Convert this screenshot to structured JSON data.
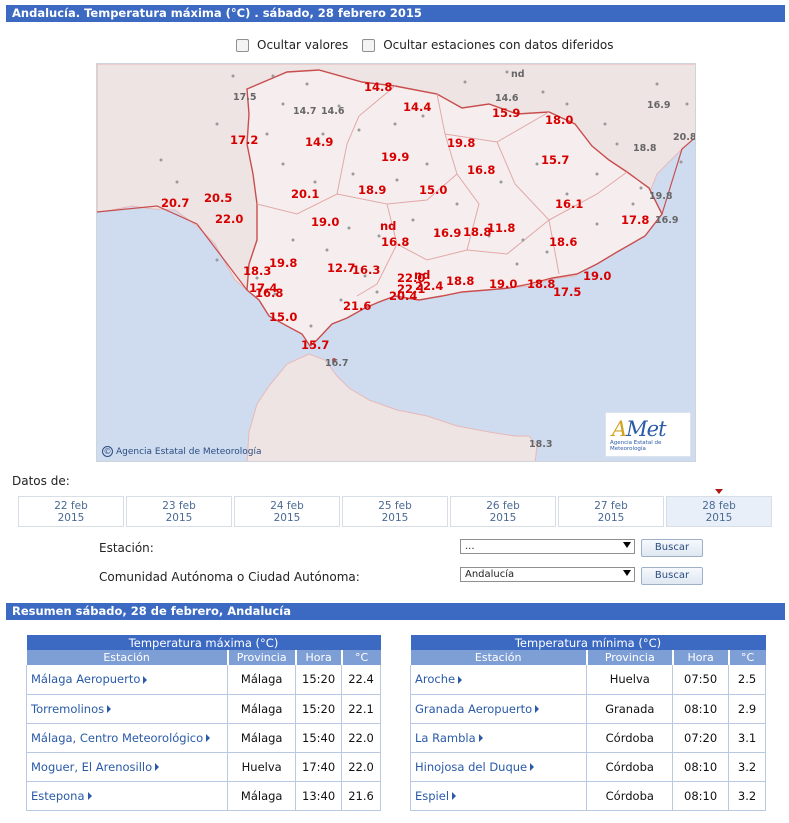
{
  "header": {
    "title": "Andalucía. Temperatura máxima (°C) . sábado, 28 febrero 2015"
  },
  "options": {
    "hide_values": "Ocultar valores",
    "hide_deferred": "Ocultar estaciones con datos diferidos"
  },
  "map": {
    "credit": "Agencia Estatal de Meteorología",
    "logo_text": "Met",
    "logo_letter": "A",
    "logo_subtitle": "Agencia Estatal de Meteorología",
    "values": [
      "14.8",
      "14.4",
      "15.9",
      "18.0",
      "17.2",
      "14.9",
      "19.9",
      "19.8",
      "15.7",
      "16.8",
      "20.1",
      "18.9",
      "15.0",
      "20.7",
      "20.5",
      "22.0",
      "19.0",
      "16.1",
      "17.8",
      "nd",
      "16.8",
      "16.9",
      "18.8",
      "11.8",
      "18.6",
      "19.8",
      "12.7",
      "16.3",
      "18.3",
      "22.0",
      "nd",
      "17.4",
      "16.8",
      "22.1",
      "22.4",
      "18.8",
      "19.0",
      "18.8",
      "17.5",
      "19.0",
      "20.4",
      "21.6",
      "15.0",
      "15.7"
    ],
    "grey_values": [
      "17.5",
      "14.7",
      "14.6",
      "nd",
      "14.6",
      "16.9",
      "20.8",
      "18.8",
      "19.8",
      "16.9",
      "16.7",
      "18.3"
    ]
  },
  "dates": {
    "label": "Datos de:",
    "items": [
      {
        "day": "22 feb",
        "year": "2015"
      },
      {
        "day": "23 feb",
        "year": "2015"
      },
      {
        "day": "24 feb",
        "year": "2015"
      },
      {
        "day": "25 feb",
        "year": "2015"
      },
      {
        "day": "26 feb",
        "year": "2015"
      },
      {
        "day": "27 feb",
        "year": "2015"
      },
      {
        "day": "28 feb",
        "year": "2015"
      }
    ]
  },
  "form": {
    "station_label": "Estación:",
    "station_value": "...",
    "community_label": "Comunidad Autónoma o Ciudad Autónoma:",
    "community_value": "Andalucía",
    "search": "Buscar"
  },
  "summary": {
    "title": "Resumen sábado, 28 de febrero, Andalucía",
    "columns": [
      "Estación",
      "Provincia",
      "Hora",
      "°C"
    ],
    "max": {
      "caption": "Temperatura máxima (°C)",
      "rows": [
        [
          "Málaga Aeropuerto",
          "Málaga",
          "15:20",
          "22.4"
        ],
        [
          "Torremolinos",
          "Málaga",
          "15:20",
          "22.1"
        ],
        [
          "Málaga, Centro Meteorológico",
          "Málaga",
          "15:40",
          "22.0"
        ],
        [
          "Moguer, El Arenosillo",
          "Huelva",
          "17:40",
          "22.0"
        ],
        [
          "Estepona",
          "Málaga",
          "13:40",
          "21.6"
        ]
      ]
    },
    "min": {
      "caption": "Temperatura mínima (°C)",
      "rows": [
        [
          "Aroche",
          "Huelva",
          "07:50",
          "2.5"
        ],
        [
          "Granada Aeropuerto",
          "Granada",
          "08:10",
          "2.9"
        ],
        [
          "La Rambla",
          "Córdoba",
          "07:20",
          "3.1"
        ],
        [
          "Hinojosa del Duque",
          "Córdoba",
          "08:10",
          "3.2"
        ],
        [
          "Espiel",
          "Córdoba",
          "08:10",
          "3.2"
        ]
      ]
    }
  }
}
